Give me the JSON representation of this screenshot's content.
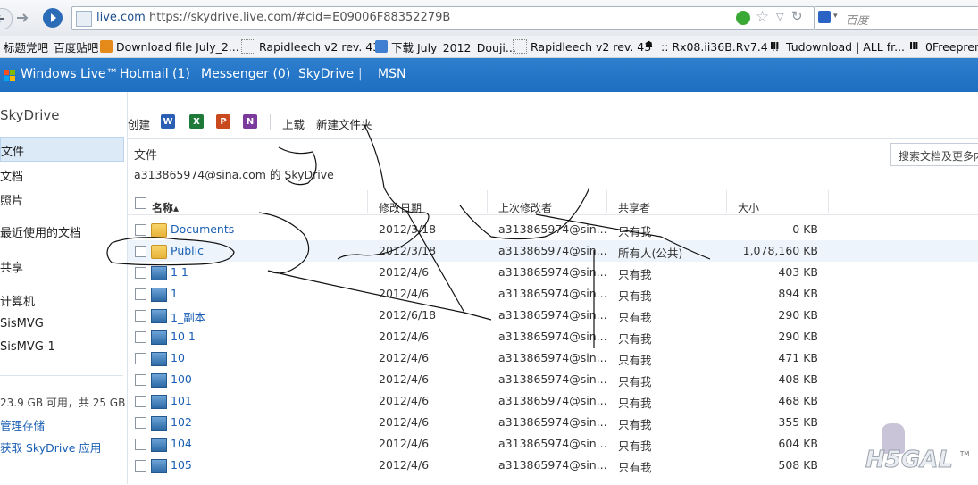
{
  "browser": {
    "url_domain": "live.com",
    "url": "https://skydrive.live.com/#cid=E09006F88352279B",
    "search_placeholder": "百度",
    "bookmarks": [
      "标题党吧_百度贴吧",
      "Download file July_2...",
      "Rapidleech v2 rev. 43",
      "下载 July_2012_Douji...",
      "Rapidleech v2 rev. 43",
      ":: Rx08.ii36B.Rv7.4 ::",
      "Tudownload | ALL fr...",
      "0Freepren"
    ]
  },
  "live_header": {
    "brand": "Windows Live™",
    "links": [
      "Hotmail (1)",
      "Messenger (0)",
      "SkyDrive",
      "|",
      "MSN"
    ]
  },
  "sidebar": {
    "title": "SkyDrive",
    "items": [
      "文件",
      "文档",
      "照片",
      "最近使用的文档",
      "共享",
      "计算机",
      "SisMVG",
      "SisMVG-1"
    ],
    "storage": "23.9 GB 可用，共 25 GB",
    "manage_storage": "管理存储",
    "get_app": "获取 SkyDrive 应用"
  },
  "toolbar": {
    "create": "创建",
    "doc_icons": [
      "W",
      "X",
      "P",
      "N"
    ],
    "upload": "上载",
    "new_folder": "新建文件夹"
  },
  "content": {
    "title": "文件",
    "owner": "a313865974@sina.com 的 SkyDrive",
    "search_docs": "搜索文档及更多内",
    "columns": [
      "名称▴",
      "修改日期",
      "上次修改者",
      "共享者",
      "大小"
    ],
    "rows": [
      {
        "icon": "folder-icon",
        "name": "Documents",
        "date": "2012/3/18",
        "modified_by": "a313865974@sin...",
        "shared": "只有我",
        "size": "0 KB"
      },
      {
        "icon": "folder-icon",
        "name": "Public",
        "date": "2012/3/18",
        "modified_by": "a313865974@sin...",
        "shared": "所有人(公共)",
        "size": "1,078,160 KB"
      },
      {
        "icon": "photo-icon",
        "name": "1 1",
        "date": "2012/4/6",
        "modified_by": "a313865974@sin...",
        "shared": "只有我",
        "size": "403 KB"
      },
      {
        "icon": "photo-icon",
        "name": "1",
        "date": "2012/4/6",
        "modified_by": "a313865974@sin...",
        "shared": "只有我",
        "size": "894 KB"
      },
      {
        "icon": "photo-icon",
        "name": "1_副本",
        "date": "2012/6/18",
        "modified_by": "a313865974@sin...",
        "shared": "只有我",
        "size": "290 KB"
      },
      {
        "icon": "photo-icon",
        "name": "10 1",
        "date": "2012/4/6",
        "modified_by": "a313865974@sin...",
        "shared": "只有我",
        "size": "290 KB"
      },
      {
        "icon": "photo-icon",
        "name": "10",
        "date": "2012/4/6",
        "modified_by": "a313865974@sin...",
        "shared": "只有我",
        "size": "471 KB"
      },
      {
        "icon": "photo-icon",
        "name": "100",
        "date": "2012/4/6",
        "modified_by": "a313865974@sin...",
        "shared": "只有我",
        "size": "408 KB"
      },
      {
        "icon": "photo-icon",
        "name": "101",
        "date": "2012/4/6",
        "modified_by": "a313865974@sin...",
        "shared": "只有我",
        "size": "468 KB"
      },
      {
        "icon": "photo-icon",
        "name": "102",
        "date": "2012/4/6",
        "modified_by": "a313865974@sin...",
        "shared": "只有我",
        "size": "355 KB"
      },
      {
        "icon": "photo-icon",
        "name": "104",
        "date": "2012/4/6",
        "modified_by": "a313865974@sin...",
        "shared": "只有我",
        "size": "604 KB"
      },
      {
        "icon": "photo-icon",
        "name": "105",
        "date": "2012/4/6",
        "modified_by": "a313865974@sin...",
        "shared": "只有我",
        "size": "508 KB"
      }
    ]
  },
  "watermark": {
    "text": "H5GAL",
    "tm": "TM"
  },
  "colors": {
    "live_blue": "#1e6ec1",
    "link": "#1a5fb4",
    "folder": "#e7b23a"
  }
}
